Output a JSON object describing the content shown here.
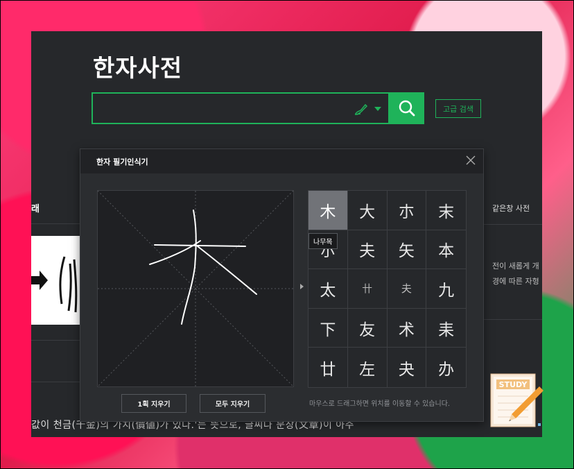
{
  "app": {
    "title": "한자사전",
    "search": {
      "value": "",
      "placeholder": ""
    },
    "advanced_search_label": "고급 검색",
    "left_section_label": "래",
    "right_section_label": "같은창 사전",
    "right_text_lines": [
      "전이 새롭게 개",
      "경에 따른 자형"
    ],
    "bottom_text": "값이 천금(千金)의 가치(價値)가 있다.'는 뜻으로, 글씨나 문장(文章)이 아주"
  },
  "modal": {
    "title": "한자 필기인식기",
    "clear_one_label": "1획 지우기",
    "clear_all_label": "모두 지우기",
    "hint": "마우스로 드래그하면 위치를 이동할 수 있습니다.",
    "tooltip": "나무목",
    "candidates": [
      "木",
      "大",
      "朩",
      "末",
      "朩",
      "夫",
      "矢",
      "本",
      "太",
      "卄",
      "夫",
      "九",
      "下",
      "友",
      "术",
      "耒",
      "廿",
      "左",
      "夬",
      "办"
    ],
    "selected_index": 0
  },
  "colors": {
    "accent": "#1fb35a",
    "panel": "#26282b",
    "modal": "#2b2d30"
  },
  "icons": [
    "pen-icon",
    "search-icon",
    "close-icon",
    "study-icon"
  ]
}
